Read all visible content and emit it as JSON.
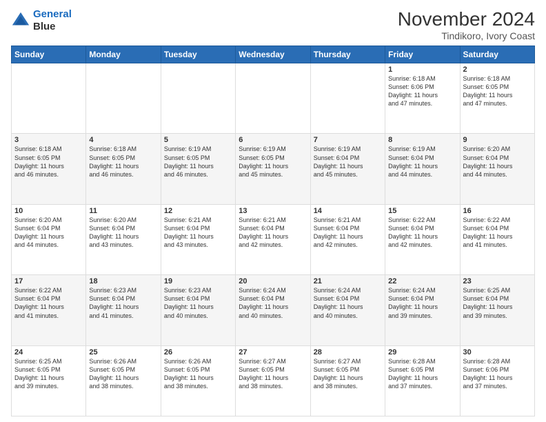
{
  "header": {
    "logo_line1": "General",
    "logo_line2": "Blue",
    "month_title": "November 2024",
    "location": "Tindikoro, Ivory Coast"
  },
  "weekdays": [
    "Sunday",
    "Monday",
    "Tuesday",
    "Wednesday",
    "Thursday",
    "Friday",
    "Saturday"
  ],
  "weeks": [
    [
      {
        "day": "",
        "info": ""
      },
      {
        "day": "",
        "info": ""
      },
      {
        "day": "",
        "info": ""
      },
      {
        "day": "",
        "info": ""
      },
      {
        "day": "",
        "info": ""
      },
      {
        "day": "1",
        "info": "Sunrise: 6:18 AM\nSunset: 6:06 PM\nDaylight: 11 hours\nand 47 minutes."
      },
      {
        "day": "2",
        "info": "Sunrise: 6:18 AM\nSunset: 6:05 PM\nDaylight: 11 hours\nand 47 minutes."
      }
    ],
    [
      {
        "day": "3",
        "info": "Sunrise: 6:18 AM\nSunset: 6:05 PM\nDaylight: 11 hours\nand 46 minutes."
      },
      {
        "day": "4",
        "info": "Sunrise: 6:18 AM\nSunset: 6:05 PM\nDaylight: 11 hours\nand 46 minutes."
      },
      {
        "day": "5",
        "info": "Sunrise: 6:19 AM\nSunset: 6:05 PM\nDaylight: 11 hours\nand 46 minutes."
      },
      {
        "day": "6",
        "info": "Sunrise: 6:19 AM\nSunset: 6:05 PM\nDaylight: 11 hours\nand 45 minutes."
      },
      {
        "day": "7",
        "info": "Sunrise: 6:19 AM\nSunset: 6:04 PM\nDaylight: 11 hours\nand 45 minutes."
      },
      {
        "day": "8",
        "info": "Sunrise: 6:19 AM\nSunset: 6:04 PM\nDaylight: 11 hours\nand 44 minutes."
      },
      {
        "day": "9",
        "info": "Sunrise: 6:20 AM\nSunset: 6:04 PM\nDaylight: 11 hours\nand 44 minutes."
      }
    ],
    [
      {
        "day": "10",
        "info": "Sunrise: 6:20 AM\nSunset: 6:04 PM\nDaylight: 11 hours\nand 44 minutes."
      },
      {
        "day": "11",
        "info": "Sunrise: 6:20 AM\nSunset: 6:04 PM\nDaylight: 11 hours\nand 43 minutes."
      },
      {
        "day": "12",
        "info": "Sunrise: 6:21 AM\nSunset: 6:04 PM\nDaylight: 11 hours\nand 43 minutes."
      },
      {
        "day": "13",
        "info": "Sunrise: 6:21 AM\nSunset: 6:04 PM\nDaylight: 11 hours\nand 42 minutes."
      },
      {
        "day": "14",
        "info": "Sunrise: 6:21 AM\nSunset: 6:04 PM\nDaylight: 11 hours\nand 42 minutes."
      },
      {
        "day": "15",
        "info": "Sunrise: 6:22 AM\nSunset: 6:04 PM\nDaylight: 11 hours\nand 42 minutes."
      },
      {
        "day": "16",
        "info": "Sunrise: 6:22 AM\nSunset: 6:04 PM\nDaylight: 11 hours\nand 41 minutes."
      }
    ],
    [
      {
        "day": "17",
        "info": "Sunrise: 6:22 AM\nSunset: 6:04 PM\nDaylight: 11 hours\nand 41 minutes."
      },
      {
        "day": "18",
        "info": "Sunrise: 6:23 AM\nSunset: 6:04 PM\nDaylight: 11 hours\nand 41 minutes."
      },
      {
        "day": "19",
        "info": "Sunrise: 6:23 AM\nSunset: 6:04 PM\nDaylight: 11 hours\nand 40 minutes."
      },
      {
        "day": "20",
        "info": "Sunrise: 6:24 AM\nSunset: 6:04 PM\nDaylight: 11 hours\nand 40 minutes."
      },
      {
        "day": "21",
        "info": "Sunrise: 6:24 AM\nSunset: 6:04 PM\nDaylight: 11 hours\nand 40 minutes."
      },
      {
        "day": "22",
        "info": "Sunrise: 6:24 AM\nSunset: 6:04 PM\nDaylight: 11 hours\nand 39 minutes."
      },
      {
        "day": "23",
        "info": "Sunrise: 6:25 AM\nSunset: 6:04 PM\nDaylight: 11 hours\nand 39 minutes."
      }
    ],
    [
      {
        "day": "24",
        "info": "Sunrise: 6:25 AM\nSunset: 6:05 PM\nDaylight: 11 hours\nand 39 minutes."
      },
      {
        "day": "25",
        "info": "Sunrise: 6:26 AM\nSunset: 6:05 PM\nDaylight: 11 hours\nand 38 minutes."
      },
      {
        "day": "26",
        "info": "Sunrise: 6:26 AM\nSunset: 6:05 PM\nDaylight: 11 hours\nand 38 minutes."
      },
      {
        "day": "27",
        "info": "Sunrise: 6:27 AM\nSunset: 6:05 PM\nDaylight: 11 hours\nand 38 minutes."
      },
      {
        "day": "28",
        "info": "Sunrise: 6:27 AM\nSunset: 6:05 PM\nDaylight: 11 hours\nand 38 minutes."
      },
      {
        "day": "29",
        "info": "Sunrise: 6:28 AM\nSunset: 6:05 PM\nDaylight: 11 hours\nand 37 minutes."
      },
      {
        "day": "30",
        "info": "Sunrise: 6:28 AM\nSunset: 6:06 PM\nDaylight: 11 hours\nand 37 minutes."
      }
    ]
  ]
}
